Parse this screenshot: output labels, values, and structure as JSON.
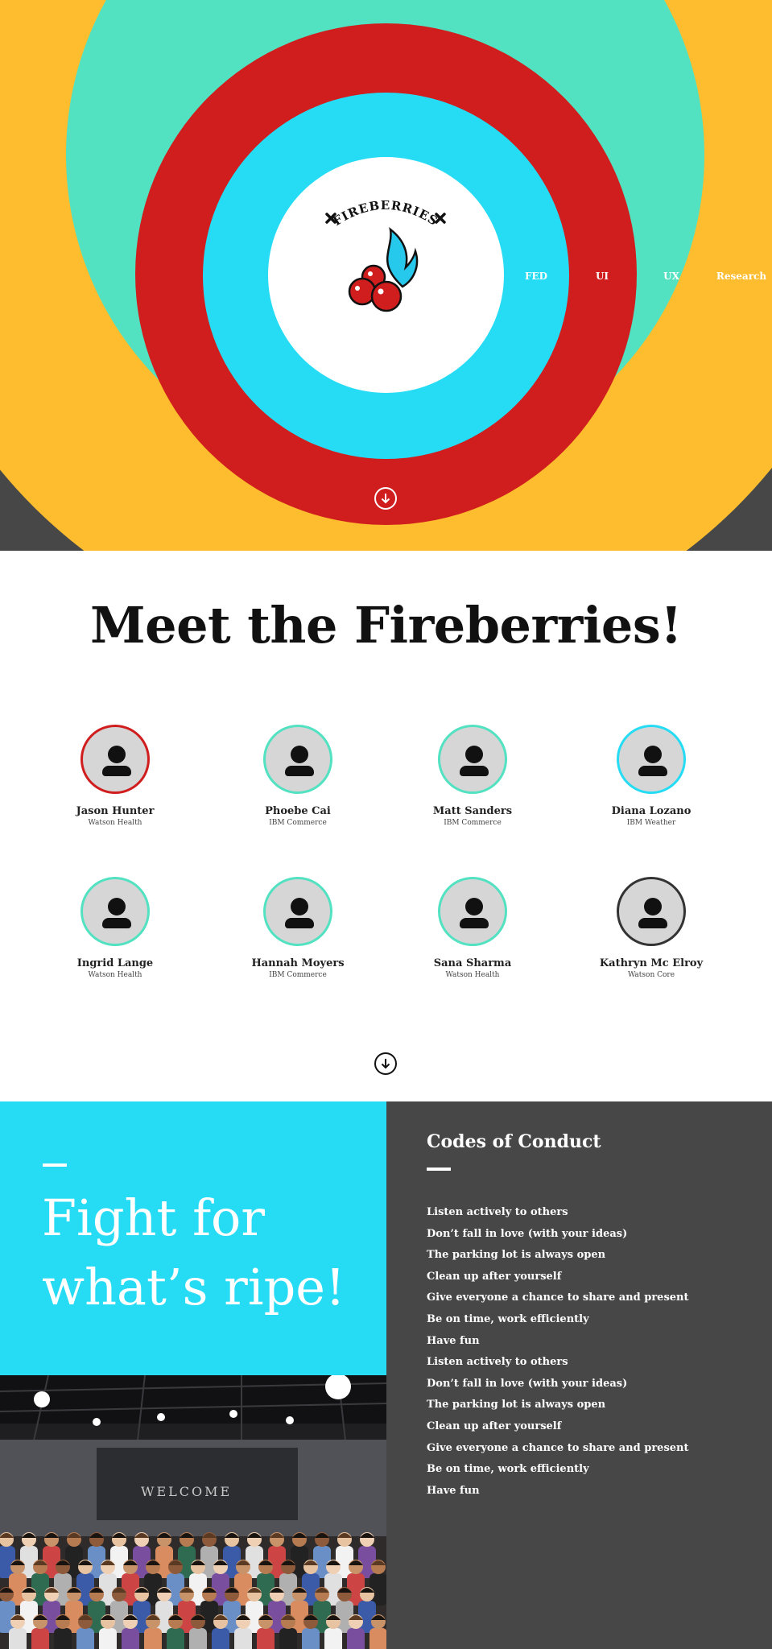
{
  "colors": {
    "dark_gray": "#474747",
    "yellow": "#fdbd2e",
    "mint": "#52e2c1",
    "red": "#d01d1d",
    "cyan": "#26dcf4",
    "white": "#ffffff"
  },
  "hero": {
    "logo_text": "FIREBERRIES",
    "nav": [
      {
        "label": "FED"
      },
      {
        "label": "UI"
      },
      {
        "label": "UX"
      },
      {
        "label": "Research"
      }
    ],
    "down_icon": "arrow-down-circle-icon"
  },
  "meet": {
    "title": "Meet the Fireberries!",
    "members": [
      {
        "name": "Jason Hunter",
        "team": "Watson Health",
        "ring_color": "#d01d1d"
      },
      {
        "name": "Phoebe Cai",
        "team": "IBM Commerce",
        "ring_color": "#52e2c1"
      },
      {
        "name": "Matt Sanders",
        "team": "IBM Commerce",
        "ring_color": "#52e2c1"
      },
      {
        "name": "Diana Lozano",
        "team": "IBM Weather",
        "ring_color": "#26dcf4"
      },
      {
        "name": "Ingrid Lange",
        "team": "Watson Health",
        "ring_color": "#52e2c1"
      },
      {
        "name": "Hannah Moyers",
        "team": "IBM Commerce",
        "ring_color": "#52e2c1"
      },
      {
        "name": "Sana Sharma",
        "team": "Watson Health",
        "ring_color": "#52e2c1"
      },
      {
        "name": "Kathryn Mc Elroy",
        "team": "Watson Core",
        "ring_color": "#333333"
      }
    ],
    "down_icon": "arrow-down-circle-icon"
  },
  "fight": {
    "line1": "Fight for",
    "line2": "what’s ripe!"
  },
  "codes": {
    "title": "Codes of Conduct",
    "items": [
      "Listen actively to others",
      "Don’t fall in love (with your ideas)",
      "The parking lot is always open",
      "Clean up after yourself",
      "Give everyone a chance to share and present",
      "Be on time, work efficiently",
      "Have fun",
      "Listen actively to others",
      "Don’t fall in love (with your ideas)",
      "The parking lot is always open",
      "Clean up after yourself",
      "Give everyone a chance to share and present",
      "Be on time, work efficiently",
      "Have fun"
    ]
  },
  "photo": {
    "banner_text": "WELCOME"
  }
}
